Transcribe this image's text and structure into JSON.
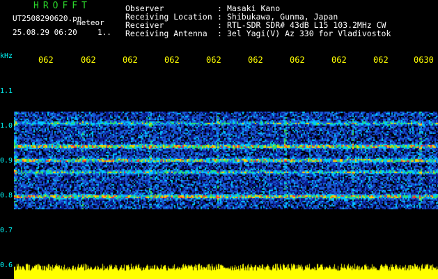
{
  "header": {
    "app_title": "HROFFT",
    "filename": "UT2508290620.pn",
    "mode": "meteor",
    "datetime": "25.08.29 06:20",
    "counter": "1.."
  },
  "station": {
    "rows": [
      {
        "label": "Observer",
        "sep": ":",
        "value": "Masaki Kano"
      },
      {
        "label": "Receiving Location",
        "sep": ":",
        "value": "Shibukawa, Gunma, Japan"
      },
      {
        "label": "Receiver",
        "sep": ":",
        "value": "RTL-SDR SDR# 43dB L15 103.2MHz CW"
      },
      {
        "label": "Receiving Antenna",
        "sep": ":",
        "value": "3el Yagi(V) Az 330 for Vladivostok"
      }
    ]
  },
  "axis": {
    "unit": "kHz",
    "y_ticks": [
      "1.1",
      "1.0",
      "0.9",
      "0.8",
      "0.7",
      "0.6"
    ],
    "x_ticks": [
      "062",
      "062",
      "062",
      "062",
      "062",
      "062",
      "062",
      "062",
      "062",
      "0630"
    ]
  },
  "colors": {
    "background": "#000000",
    "title": "#2bd62b",
    "text": "#ffffff",
    "tick_x": "#ffff00",
    "tick_y": "#00ffff",
    "spectrum_low": "#0a1a8c",
    "spectrum_mid": "#00c8ff",
    "spectrum_high": "#ff3030",
    "amplitude": "#ffff00"
  }
}
